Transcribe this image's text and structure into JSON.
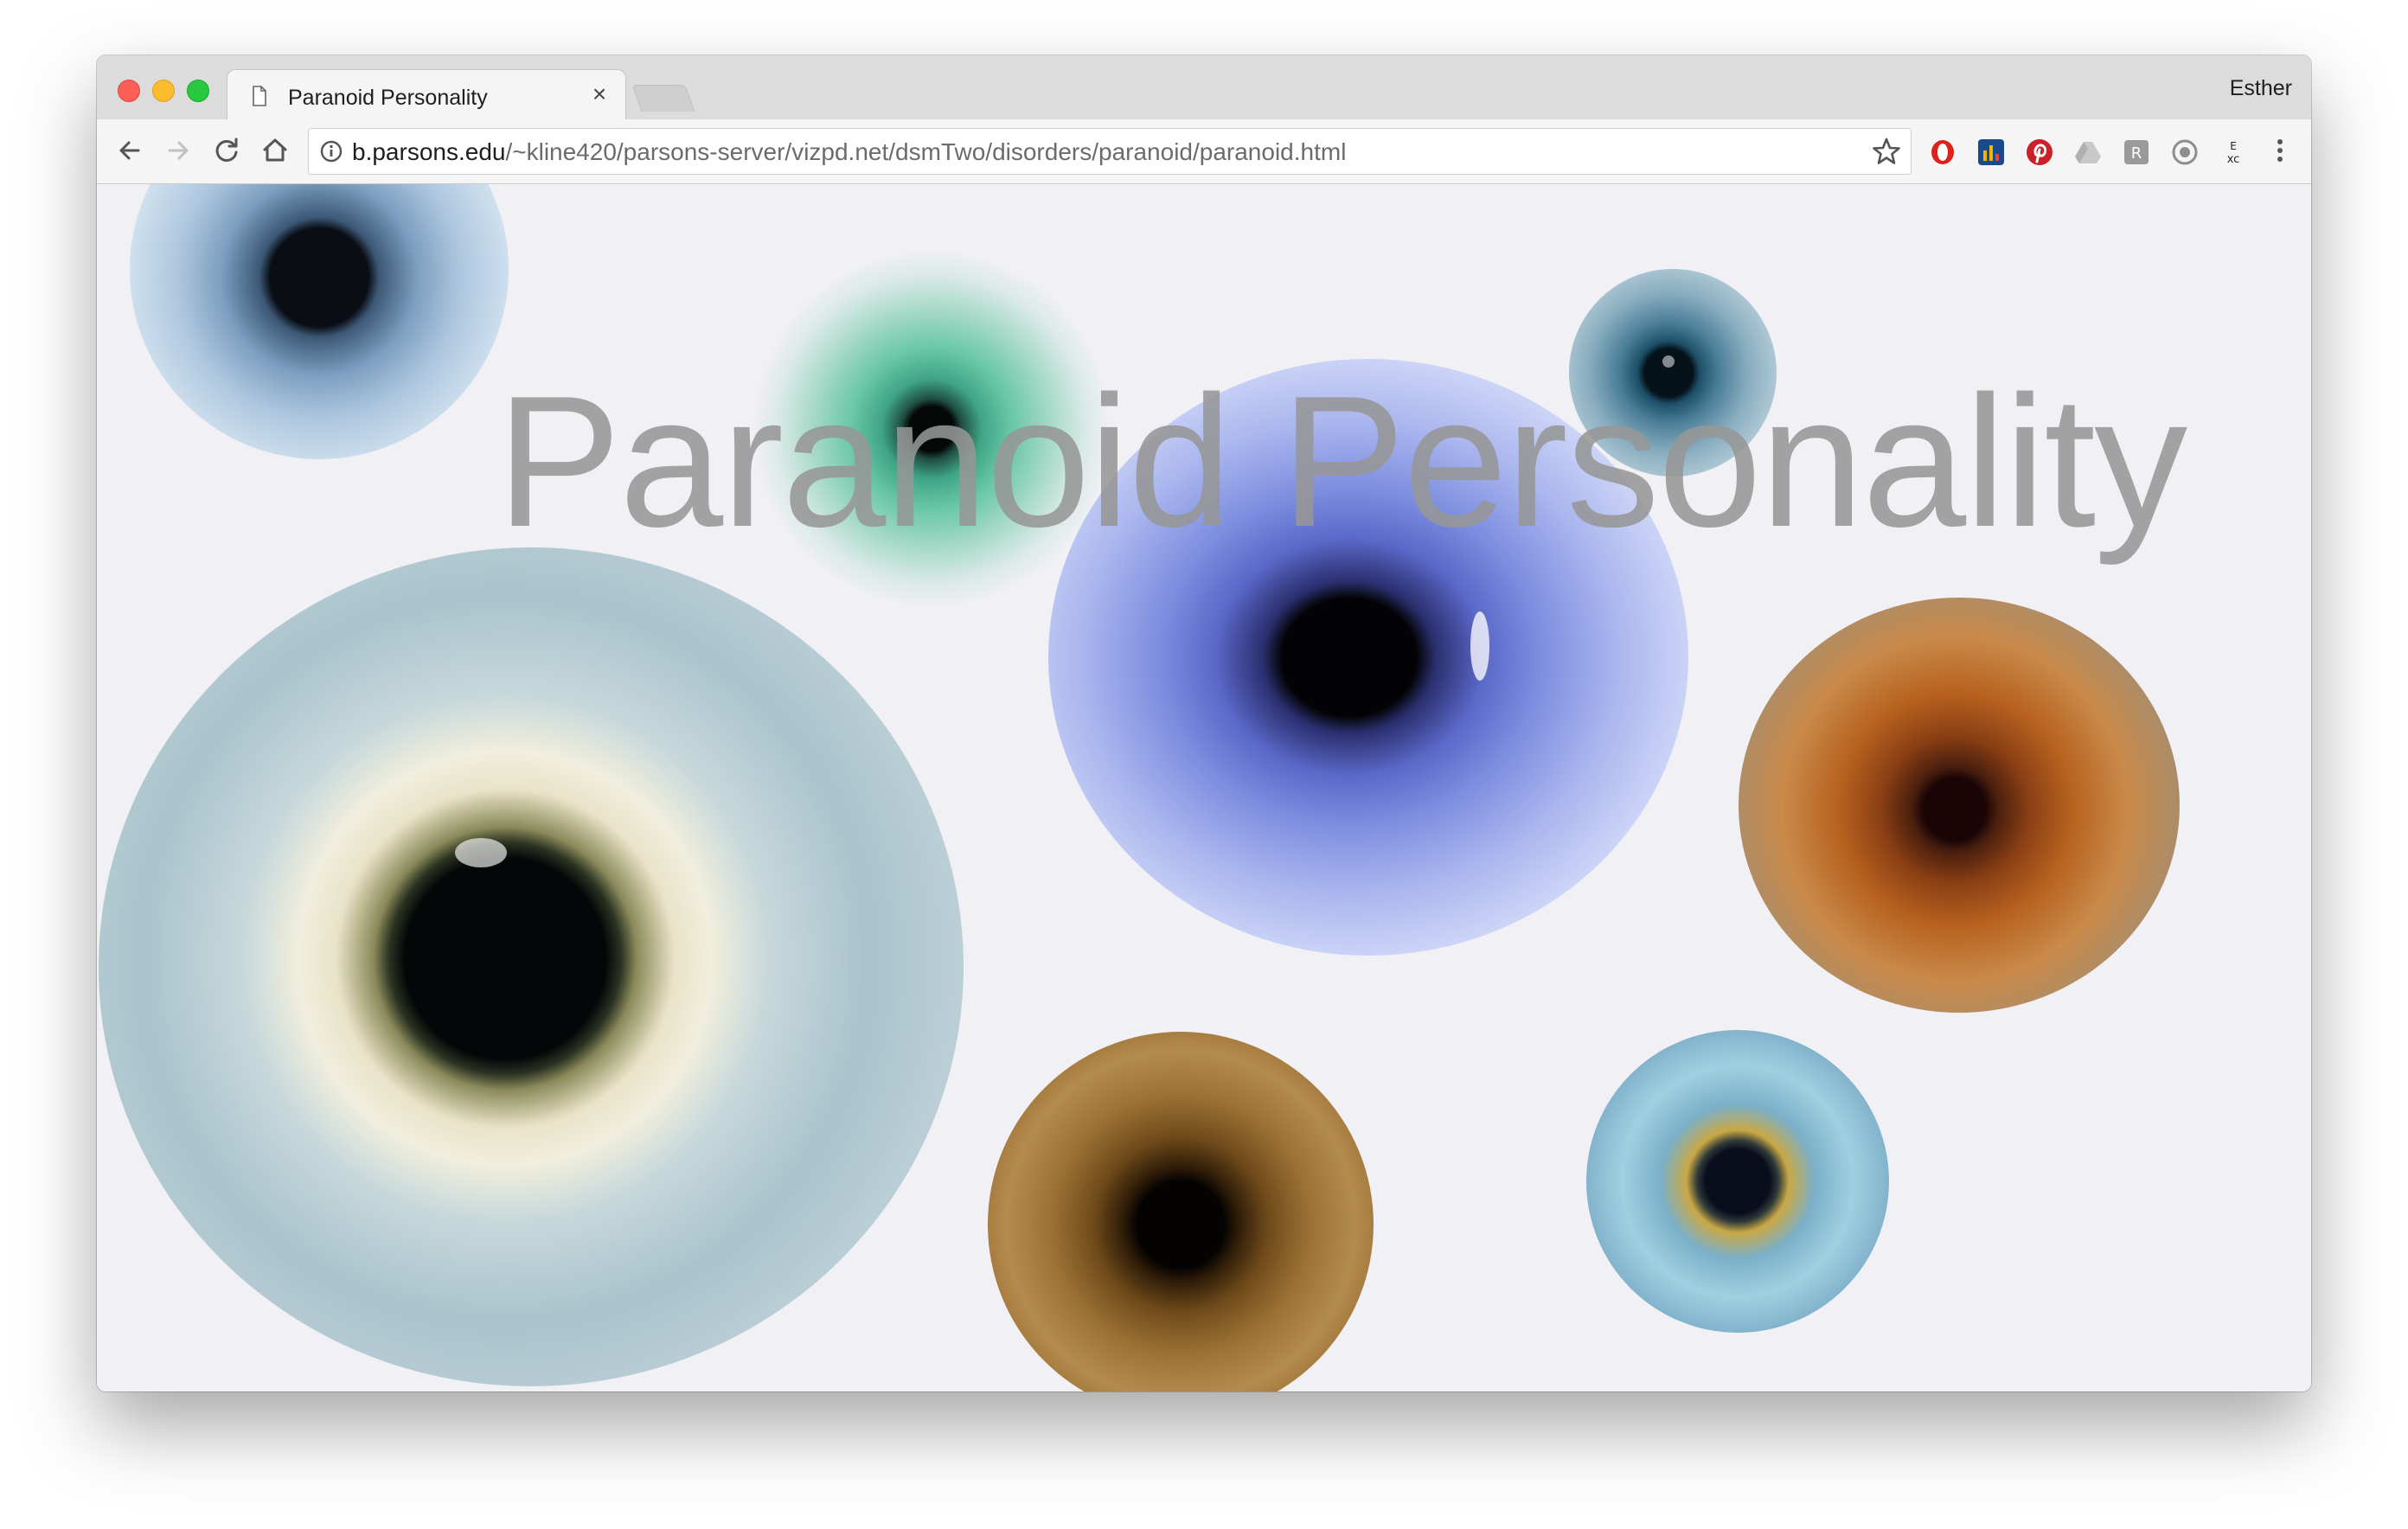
{
  "tab": {
    "title": "Paranoid Personality"
  },
  "profile": {
    "name": "Esther"
  },
  "address_bar": {
    "host": "b.parsons.edu",
    "path": "/~kline420/parsons-server/vizpd.net/dsmTwo/disorders/paranoid/paranoid.html"
  },
  "page": {
    "heading": "Paranoid Personality"
  },
  "toolbar": {
    "icons": [
      "back-icon",
      "forward-icon",
      "reload-icon",
      "home-icon",
      "info-icon",
      "bookmark-star-icon"
    ],
    "extensions": [
      "opera-icon",
      "analytics-icon",
      "pinterest-icon",
      "drive-icon",
      "extension-icon",
      "vpn-icon",
      "exc-icon",
      "menu-icon"
    ]
  },
  "colors": {
    "tab_strip": "#dcdcdc",
    "page_background": "#f1f0f5",
    "heading": "#969696"
  }
}
